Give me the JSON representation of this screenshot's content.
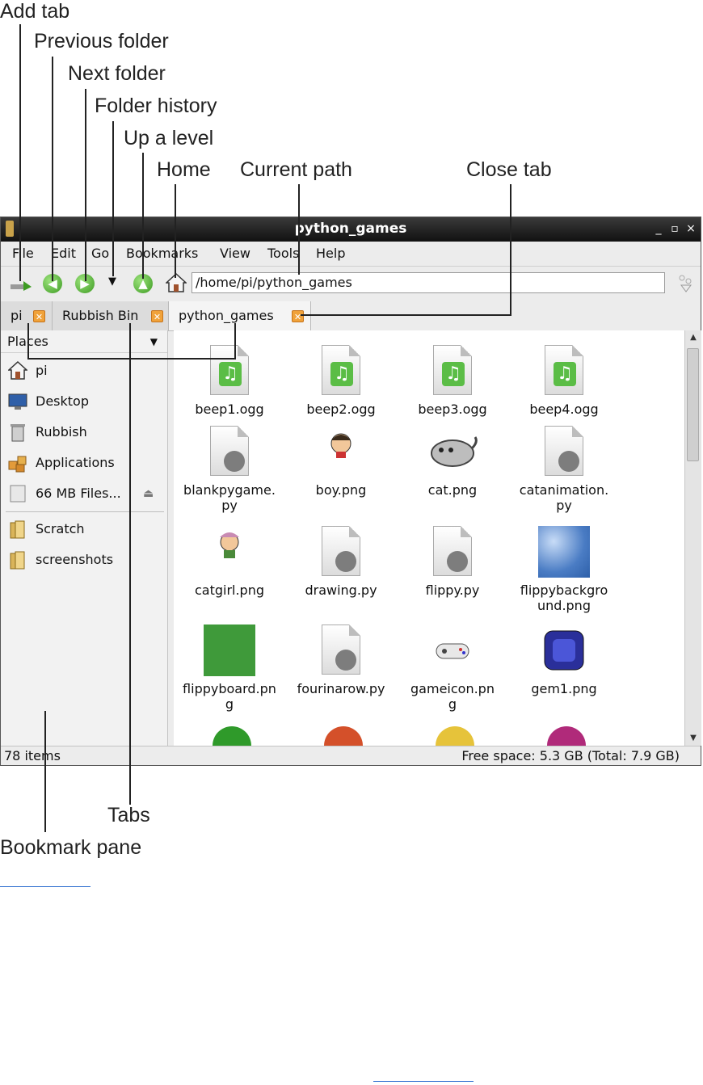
{
  "callouts": {
    "add_tab": "Add tab",
    "previous_folder": "Previous folder",
    "next_folder": "Next folder",
    "folder_history": "Folder history",
    "up_a_level": "Up a level",
    "home": "Home",
    "current_path": "Current path",
    "close_tab": "Close tab",
    "tabs": "Tabs",
    "bookmark_pane": "Bookmark pane"
  },
  "window": {
    "title": "python_games",
    "controls": [
      "_",
      "▫",
      "×"
    ]
  },
  "menu": [
    "File",
    "Edit",
    "Go",
    "Bookmarks",
    "View",
    "Tools",
    "Help"
  ],
  "toolbar": {
    "path": "/home/pi/python_games"
  },
  "tabs": [
    {
      "label": "pi",
      "close": "✕"
    },
    {
      "label": "Rubbish Bin",
      "close": "✕"
    },
    {
      "label": "python_games",
      "close": "✕"
    }
  ],
  "sidebar": {
    "header": "Places",
    "items": [
      {
        "label": "pi",
        "icon": "home-icon"
      },
      {
        "label": "Desktop",
        "icon": "desktop-icon"
      },
      {
        "label": "Rubbish",
        "icon": "trash-icon"
      },
      {
        "label": "Applications",
        "icon": "applications-icon"
      },
      {
        "label": "66 MB Files...",
        "icon": "drive-icon"
      }
    ],
    "bookmarks": [
      {
        "label": "Scratch",
        "icon": "folder-icon"
      },
      {
        "label": "screenshots",
        "icon": "folder-icon"
      }
    ]
  },
  "files": [
    {
      "name": "beep1.ogg",
      "kind": "audio"
    },
    {
      "name": "beep2.ogg",
      "kind": "audio"
    },
    {
      "name": "beep3.ogg",
      "kind": "audio"
    },
    {
      "name": "beep4.ogg",
      "kind": "audio"
    },
    {
      "name": "blankpygame.\npy",
      "kind": "script"
    },
    {
      "name": "boy.png",
      "kind": "boy"
    },
    {
      "name": "cat.png",
      "kind": "cat"
    },
    {
      "name": "catanimation.\npy",
      "kind": "script"
    },
    {
      "name": "catgirl.png",
      "kind": "catgirl"
    },
    {
      "name": "drawing.py",
      "kind": "script"
    },
    {
      "name": "flippy.py",
      "kind": "script"
    },
    {
      "name": "flippybackgro\nund.png",
      "kind": "sky"
    },
    {
      "name": "flippyboard.pn\ng",
      "kind": "board"
    },
    {
      "name": "fourinarow.py",
      "kind": "script"
    },
    {
      "name": "gameicon.pn\ng",
      "kind": "gamepad"
    },
    {
      "name": "gem1.png",
      "kind": "gem"
    }
  ],
  "status": {
    "items": "78 items",
    "free_space": "Free space: 5.3 GB (Total: 7.9 GB)"
  }
}
